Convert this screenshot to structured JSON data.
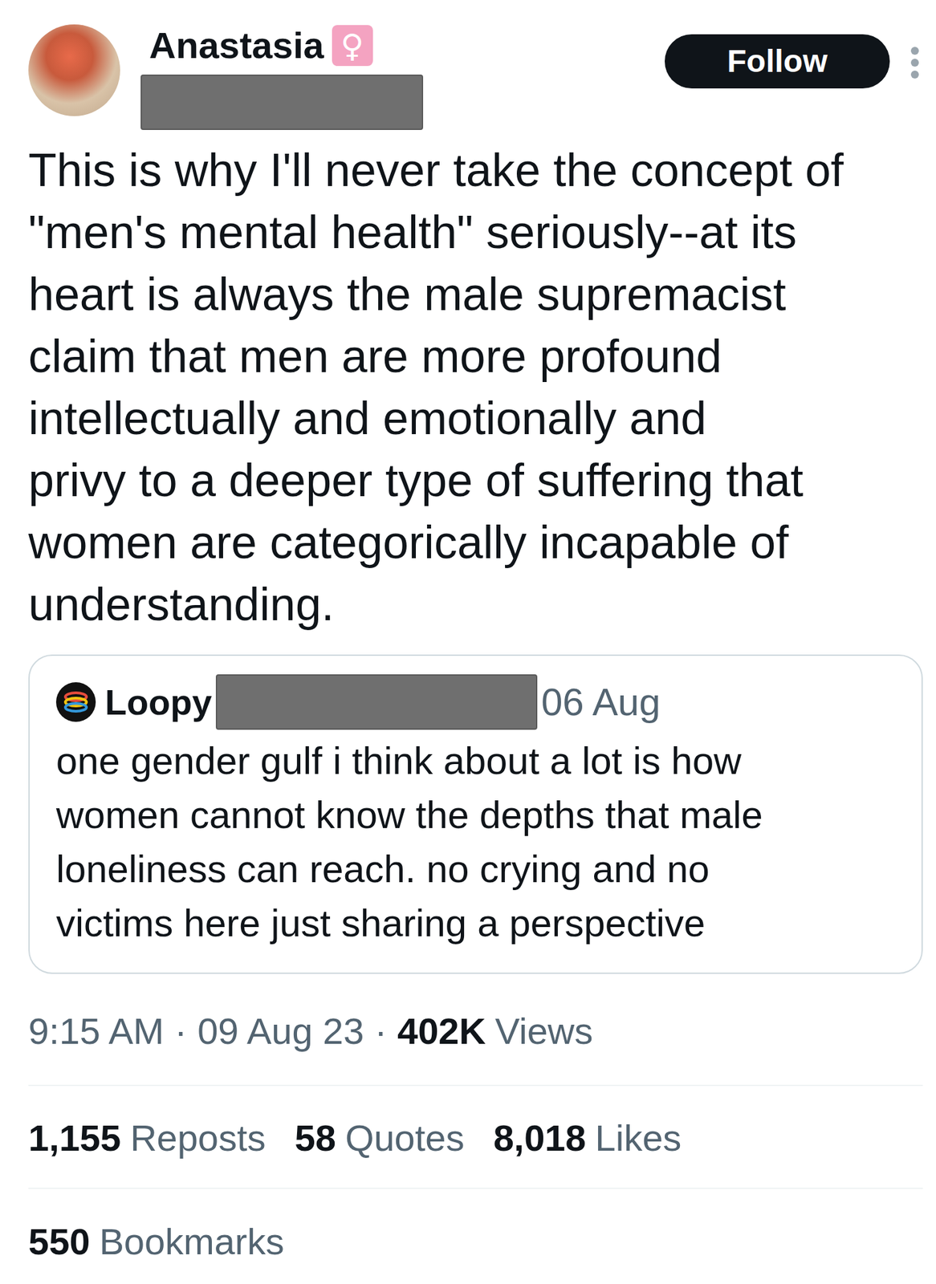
{
  "post": {
    "author": {
      "name": "Anastasia",
      "badge": "♀"
    },
    "follow_button": "Follow",
    "text_lines": [
      "This is why I'll never take the concept of",
      "\"men's mental health\" seriously--at its",
      "heart is always the male supremacist",
      "claim that men are more profound",
      "intellectually and emotionally and",
      "privy to a deeper type of suffering that",
      "women are categorically incapable of",
      "understanding."
    ],
    "quoted": {
      "author": "Loopy",
      "date": "06 Aug",
      "text_lines": [
        "one gender gulf i think about a lot is how",
        "women cannot know the depths that male",
        "loneliness can reach. no crying and no",
        "victims here just sharing a perspective"
      ]
    },
    "meta": {
      "time": "9:15 AM",
      "separator": "·",
      "date": "09 Aug 23",
      "views_count": "402K",
      "views_label": "Views"
    },
    "stats": [
      {
        "count": "1,155",
        "label": "Reposts"
      },
      {
        "count": "58",
        "label": "Quotes"
      },
      {
        "count": "8,018",
        "label": "Likes"
      }
    ],
    "bookmarks": {
      "count": "550",
      "label": "Bookmarks"
    }
  }
}
